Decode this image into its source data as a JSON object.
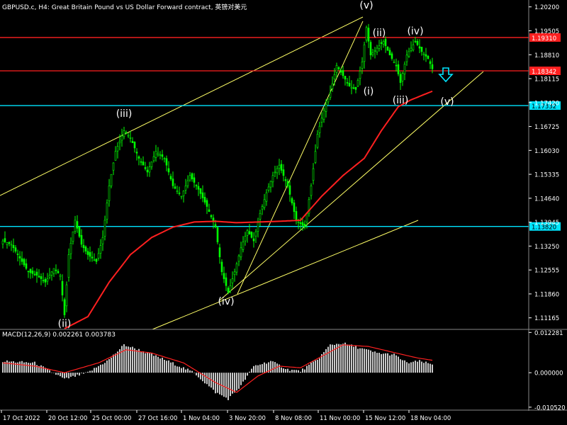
{
  "window": {
    "title": "GBPUSD.c, H4:  Great Britain Pound vs US Dollar Forward contract, 英镑对美元"
  },
  "colors": {
    "background": "#000000",
    "bull_candle": "#00ff00",
    "bear_candle": "#00ff00",
    "ma_line": "#ff2020",
    "channel_line": "#ffff66",
    "resistance_line": "#ff2020",
    "support_line": "#00e5ff",
    "wave_label": "#ffffff",
    "macd_hist": "#c8c8c8",
    "macd_signal": "#ff2020",
    "axis_text": "#ffffff",
    "arrow": "#00e5ff"
  },
  "price_axis": {
    "ticks": [
      "1.20200",
      "1.19505",
      "1.18810",
      "1.18115",
      "1.17420",
      "1.16725",
      "1.16030",
      "1.15335",
      "1.14640",
      "1.13945",
      "1.13250",
      "1.12555",
      "1.11860",
      "1.11165"
    ],
    "ylim": [
      1.1085,
      1.204
    ]
  },
  "hlines": [
    {
      "name": "resistance-upper",
      "price": 1.1931,
      "label": "1.19310",
      "color": "#ff2020"
    },
    {
      "name": "resistance-lower",
      "price": 1.18342,
      "label": "1.18342",
      "color": "#ff2020"
    },
    {
      "name": "support-upper",
      "price": 1.17332,
      "label": "1.17332",
      "color": "#00e5ff"
    },
    {
      "name": "support-lower",
      "price": 1.1382,
      "label": "1.13820",
      "color": "#00e5ff"
    }
  ],
  "wave_labels": [
    {
      "text": "(ii)",
      "bar": 29,
      "price": 1.109
    },
    {
      "text": "(iii)",
      "bar": 57,
      "price": 1.17
    },
    {
      "text": "(iv)",
      "bar": 105,
      "price": 1.1155
    },
    {
      "text": "(v)",
      "bar": 171,
      "price": 1.2015
    },
    {
      "text": "(i)",
      "bar": 172,
      "price": 1.1765
    },
    {
      "text": "(ii)",
      "bar": 177,
      "price": 1.1935
    },
    {
      "text": "(iii)",
      "bar": 187,
      "price": 1.174
    },
    {
      "text": "(iv)",
      "bar": 194,
      "price": 1.194
    },
    {
      "text": "(v)",
      "bar": 209,
      "price": 1.1735
    }
  ],
  "macd": {
    "label": "MACD(12,26,9) 0.002261 0.003783",
    "ticks": [
      "0.012281",
      "0.000000",
      "-0.010520"
    ],
    "ylim": [
      -0.0112,
      0.013
    ]
  },
  "time_axis": {
    "labels": [
      "17 Oct 2022",
      "20 Oct 12:00",
      "25 Oct 00:00",
      "27 Oct 16:00",
      "1 Nov 04:00",
      "3 Nov 20:00",
      "8 Nov 08:00",
      "11 Nov 00:00",
      "15 Nov 12:00",
      "18 Nov 04:00"
    ]
  },
  "chart_data": {
    "type": "candlestick",
    "symbol": "GBPUSD.c",
    "timeframe": "H4",
    "anchors": [
      [
        0,
        1.134
      ],
      [
        4,
        1.133
      ],
      [
        8,
        1.129
      ],
      [
        12,
        1.125
      ],
      [
        16,
        1.124
      ],
      [
        20,
        1.122
      ],
      [
        24,
        1.126
      ],
      [
        27,
        1.124
      ],
      [
        29,
        1.1125
      ],
      [
        31,
        1.13
      ],
      [
        34,
        1.14
      ],
      [
        37,
        1.133
      ],
      [
        40,
        1.13
      ],
      [
        44,
        1.128
      ],
      [
        47,
        1.135
      ],
      [
        50,
        1.15
      ],
      [
        53,
        1.16
      ],
      [
        57,
        1.166
      ],
      [
        60,
        1.164
      ],
      [
        64,
        1.158
      ],
      [
        68,
        1.154
      ],
      [
        72,
        1.16
      ],
      [
        76,
        1.158
      ],
      [
        80,
        1.15
      ],
      [
        84,
        1.147
      ],
      [
        88,
        1.153
      ],
      [
        92,
        1.149
      ],
      [
        96,
        1.144
      ],
      [
        100,
        1.138
      ],
      [
        103,
        1.125
      ],
      [
        106,
        1.119
      ],
      [
        109,
        1.125
      ],
      [
        112,
        1.132
      ],
      [
        115,
        1.137
      ],
      [
        118,
        1.134
      ],
      [
        121,
        1.142
      ],
      [
        124,
        1.148
      ],
      [
        127,
        1.153
      ],
      [
        130,
        1.156
      ],
      [
        134,
        1.15
      ],
      [
        138,
        1.14
      ],
      [
        142,
        1.138
      ],
      [
        145,
        1.15
      ],
      [
        148,
        1.165
      ],
      [
        151,
        1.172
      ],
      [
        154,
        1.177
      ],
      [
        157,
        1.185
      ],
      [
        160,
        1.182
      ],
      [
        163,
        1.179
      ],
      [
        166,
        1.178
      ],
      [
        169,
        1.186
      ],
      [
        171,
        1.196
      ],
      [
        173,
        1.188
      ],
      [
        176,
        1.19
      ],
      [
        179,
        1.192
      ],
      [
        182,
        1.188
      ],
      [
        185,
        1.185
      ],
      [
        187,
        1.18
      ],
      [
        190,
        1.188
      ],
      [
        194,
        1.192
      ],
      [
        197,
        1.189
      ],
      [
        200,
        1.187
      ],
      [
        202,
        1.184
      ]
    ],
    "ma_anchors": [
      [
        29,
        1.1085
      ],
      [
        40,
        1.112
      ],
      [
        50,
        1.122
      ],
      [
        60,
        1.13
      ],
      [
        70,
        1.135
      ],
      [
        80,
        1.138
      ],
      [
        90,
        1.1395
      ],
      [
        100,
        1.1397
      ],
      [
        110,
        1.1393
      ],
      [
        120,
        1.1395
      ],
      [
        130,
        1.1397
      ],
      [
        140,
        1.14
      ],
      [
        150,
        1.147
      ],
      [
        160,
        1.153
      ],
      [
        170,
        1.158
      ],
      [
        178,
        1.166
      ],
      [
        186,
        1.173
      ],
      [
        192,
        1.175
      ],
      [
        202,
        1.1775
      ]
    ],
    "macd_hist_anchors": [
      [
        0,
        0.0035
      ],
      [
        15,
        0.003
      ],
      [
        25,
        -0.0005
      ],
      [
        29,
        -0.002
      ],
      [
        40,
        0.0
      ],
      [
        50,
        0.004
      ],
      [
        57,
        0.0085
      ],
      [
        64,
        0.007
      ],
      [
        76,
        0.004
      ],
      [
        90,
        0.0
      ],
      [
        100,
        -0.006
      ],
      [
        106,
        -0.008
      ],
      [
        112,
        -0.004
      ],
      [
        118,
        0.002
      ],
      [
        126,
        0.0035
      ],
      [
        134,
        0.001
      ],
      [
        140,
        0.0005
      ],
      [
        148,
        0.004
      ],
      [
        154,
        0.0085
      ],
      [
        160,
        0.009
      ],
      [
        168,
        0.0075
      ],
      [
        176,
        0.006
      ],
      [
        184,
        0.0055
      ],
      [
        190,
        0.003
      ],
      [
        196,
        0.0035
      ],
      [
        202,
        0.0025
      ]
    ],
    "macd_signal_anchors": [
      [
        0,
        0.003
      ],
      [
        15,
        0.002
      ],
      [
        29,
        0.0
      ],
      [
        45,
        0.003
      ],
      [
        58,
        0.007
      ],
      [
        70,
        0.006
      ],
      [
        85,
        0.003
      ],
      [
        100,
        -0.003
      ],
      [
        110,
        -0.006
      ],
      [
        120,
        -0.001
      ],
      [
        130,
        0.002
      ],
      [
        140,
        0.0015
      ],
      [
        150,
        0.005
      ],
      [
        160,
        0.0085
      ],
      [
        172,
        0.008
      ],
      [
        185,
        0.006
      ],
      [
        195,
        0.0045
      ],
      [
        202,
        0.0038
      ]
    ]
  }
}
